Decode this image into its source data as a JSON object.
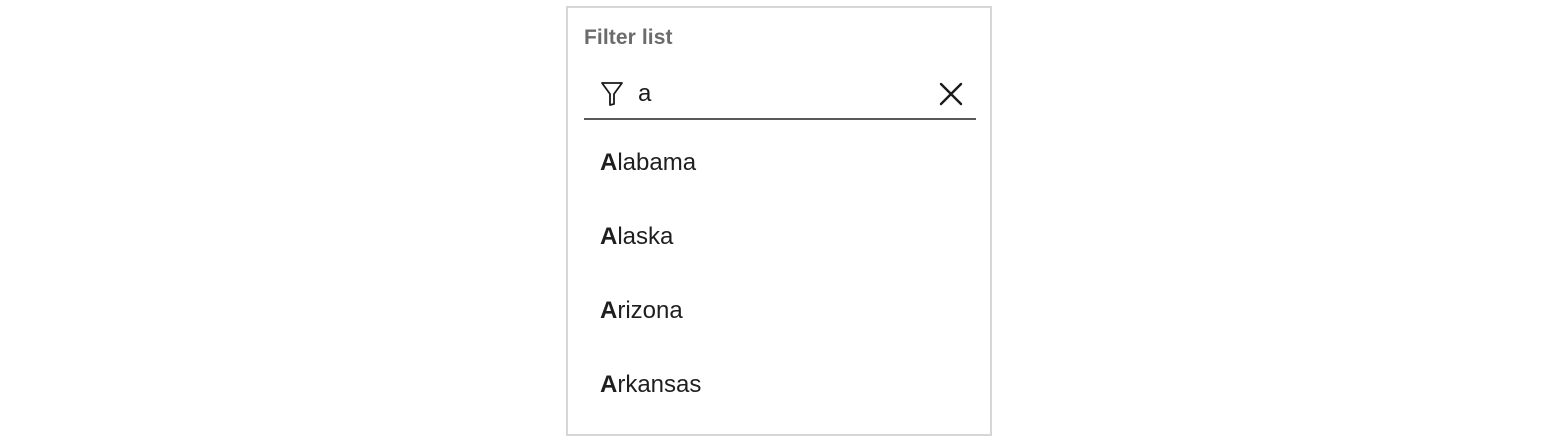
{
  "filter": {
    "label": "Filter list",
    "query": "a",
    "filter_icon": "filter-icon",
    "clear_icon": "close-icon"
  },
  "results": [
    {
      "match": "A",
      "rest": "labama"
    },
    {
      "match": "A",
      "rest": "laska"
    },
    {
      "match": "A",
      "rest": "rizona"
    },
    {
      "match": "A",
      "rest": "rkansas"
    }
  ],
  "colors": {
    "border": "#d6d6d6",
    "label": "#6b6b6b",
    "underline": "#5a5a5a",
    "text": "#1f1f1f"
  }
}
